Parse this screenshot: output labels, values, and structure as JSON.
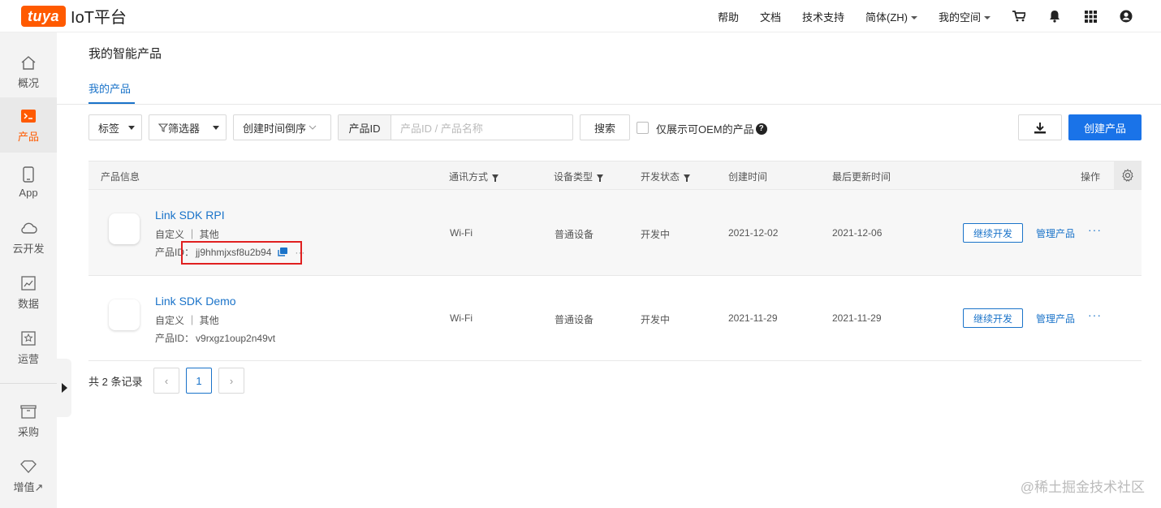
{
  "brand": {
    "badge": "tuya",
    "title": "IoT平台",
    "accent": "#ff5a00"
  },
  "topnav": {
    "help": "帮助",
    "docs": "文档",
    "support": "技术支持",
    "language": "简体(ZH)",
    "space": "我的空间",
    "icons": [
      "cart-icon",
      "bell-icon",
      "grid-icon",
      "user-icon"
    ]
  },
  "sidebar": {
    "items": [
      {
        "label": "概况",
        "icon": "home-icon"
      },
      {
        "label": "产品",
        "icon": "terminal-icon"
      },
      {
        "label": "App",
        "icon": "phone-icon"
      },
      {
        "label": "云开发",
        "icon": "cloud-icon"
      },
      {
        "label": "数据",
        "icon": "chart-icon"
      },
      {
        "label": "运营",
        "icon": "badge-icon"
      },
      {
        "label": "采购",
        "icon": "box-icon"
      },
      {
        "label": "增值↗",
        "icon": "diamond-icon"
      }
    ],
    "active_index": 1
  },
  "page": {
    "title": "我的智能产品",
    "tab": "我的产品"
  },
  "toolbar": {
    "tag": "标签",
    "filter": "筛选器",
    "sort": "创建时间倒序",
    "search_prefix": "产品ID",
    "search_placeholder": "产品ID / 产品名称",
    "search_button": "搜索",
    "oem_label": "仅展示可OEM的产品",
    "create_button": "创建产品"
  },
  "table": {
    "headers": {
      "info": "产品信息",
      "comm": "通讯方式",
      "device_type": "设备类型",
      "dev_status": "开发状态",
      "created": "创建时间",
      "updated": "最后更新时间",
      "actions": "操作"
    },
    "rows": [
      {
        "name": "Link SDK RPI",
        "category": "自定义 ｜ 其他",
        "id_label": "产品ID：",
        "id": "jj9hhmjxsf8u2b94",
        "comm": "Wi-Fi",
        "device_type": "普通设备",
        "status": "开发中",
        "created": "2021-12-02",
        "updated": "2021-12-06",
        "continue": "继续开发",
        "manage": "管理产品",
        "more": "···"
      },
      {
        "name": "Link SDK Demo",
        "category": "自定义 ｜ 其他",
        "id_label": "产品ID：",
        "id": "v9rxgz1oup2n49vt",
        "comm": "Wi-Fi",
        "device_type": "普通设备",
        "status": "开发中",
        "created": "2021-11-29",
        "updated": "2021-11-29",
        "continue": "继续开发",
        "manage": "管理产品",
        "more": "···"
      }
    ]
  },
  "pagination": {
    "total": "共 2 条记录",
    "current": "1",
    "prev": "‹",
    "next": "›"
  },
  "watermark": "@稀土掘金技术社区"
}
